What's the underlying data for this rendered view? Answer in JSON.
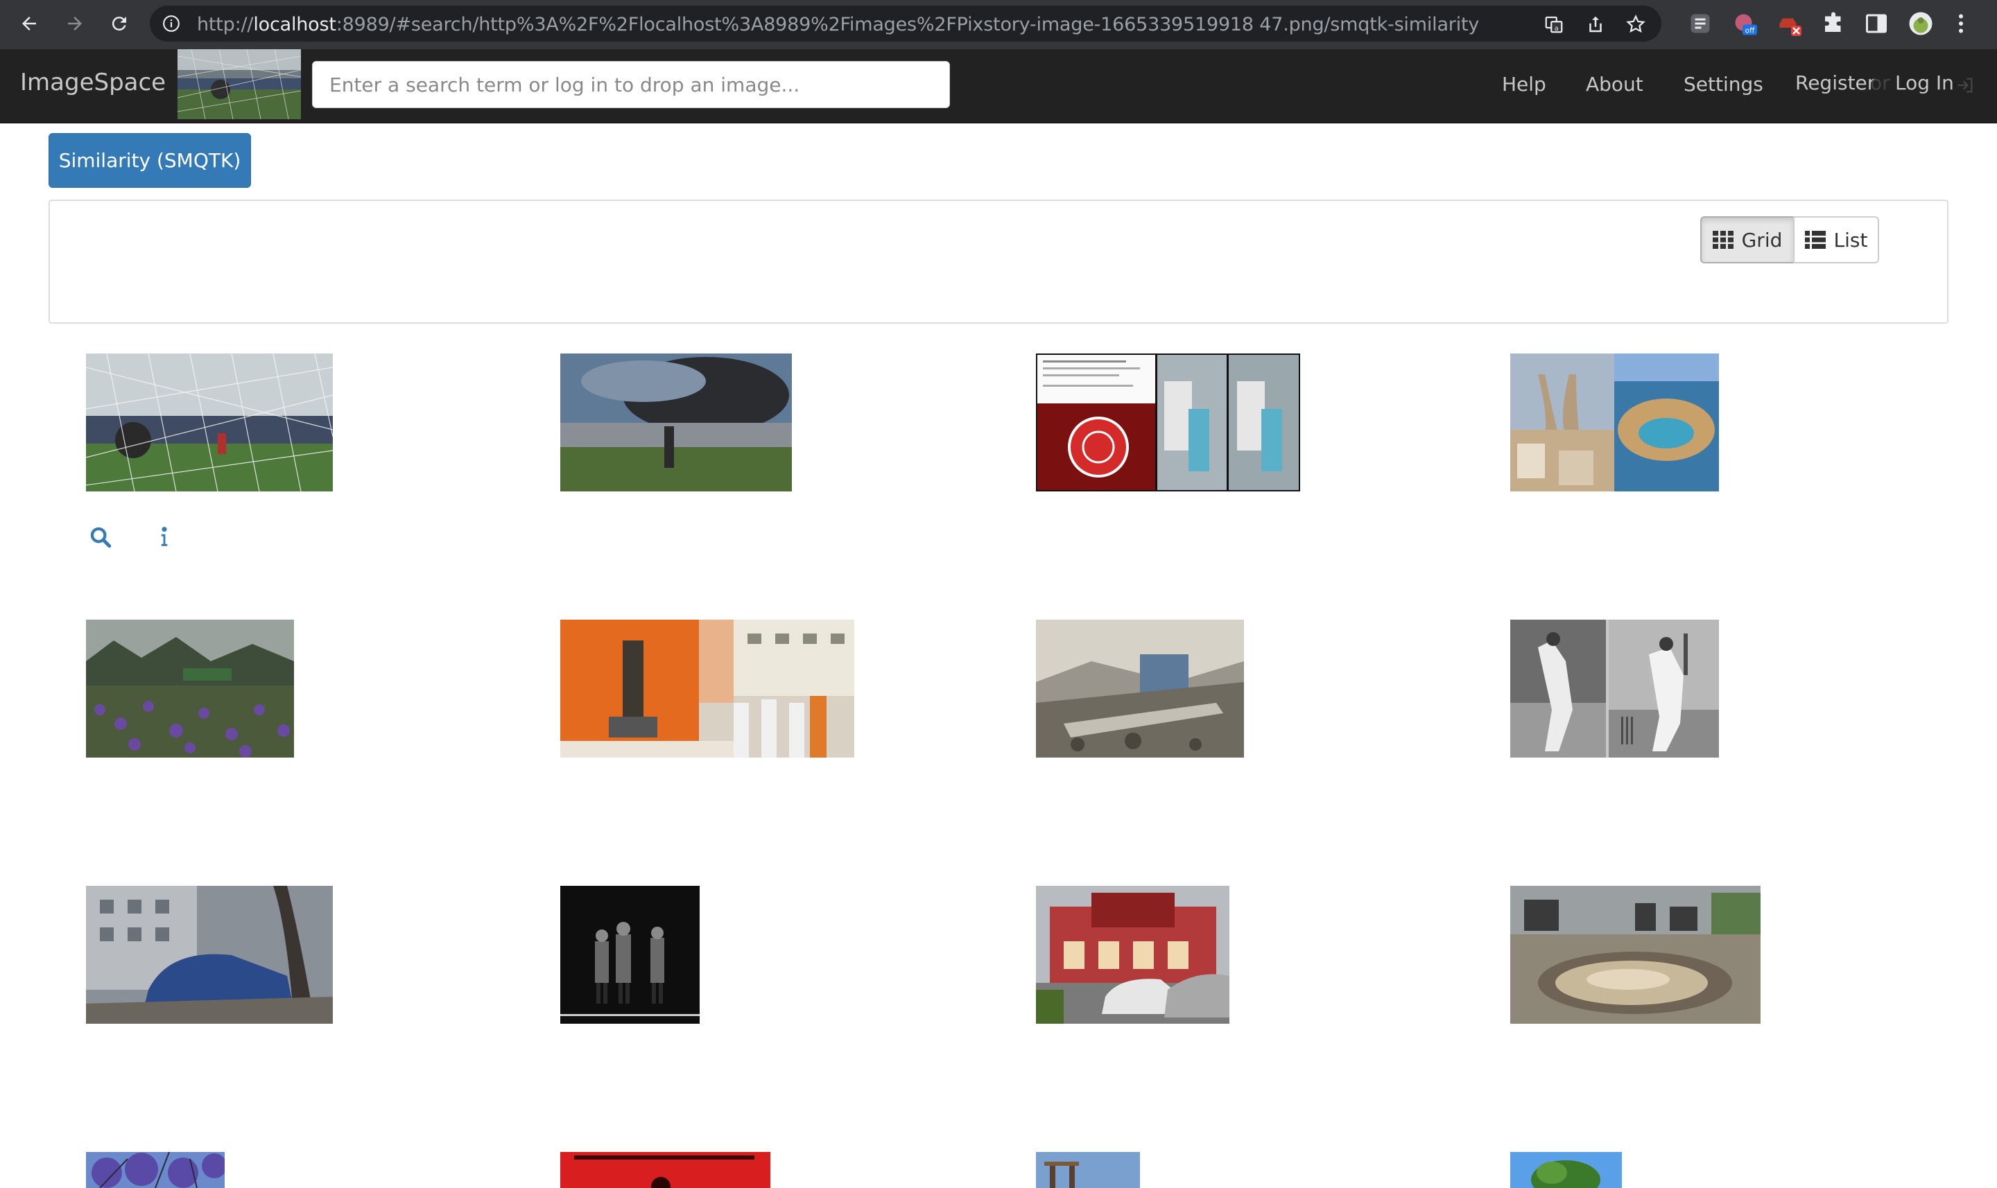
{
  "browser": {
    "url_prefix": "http://",
    "url_host": "localhost",
    "url_rest": ":8989/#search/http%3A%2F%2Flocalhost%3A8989%2Fimages%2FPixstory-image-1665339519918 47.png/smqtk-similarity",
    "back_icon": "arrow-left-icon",
    "forward_icon": "arrow-right-icon",
    "reload_icon": "reload-icon",
    "ext_badge": "off"
  },
  "navbar": {
    "brand": "ImageSpace",
    "search_placeholder": "Enter a search term or log in to drop an image...",
    "links": {
      "help": "Help",
      "about": "About",
      "settings": "Settings",
      "register": "Register",
      "or": "or",
      "login": "Log In"
    }
  },
  "content": {
    "similarity_tab": "Similarity (SMQTK)",
    "view_toggle": {
      "grid": "Grid",
      "list": "List"
    },
    "accent_color": "#337ab7",
    "result_images": [
      "football-goal-net",
      "smoke-over-city",
      "alt-fact-check-collage",
      "towers-and-cruise-ship",
      "lupine-meadow",
      "statue-ceremony",
      "collapsed-building",
      "cricket-players-bw",
      "destroyed-car",
      "night-figures",
      "red-storefront-street",
      "pothole-road",
      "purple-blossom-tree",
      "red-stage",
      "tower-structure",
      "green-tree-sky"
    ]
  }
}
